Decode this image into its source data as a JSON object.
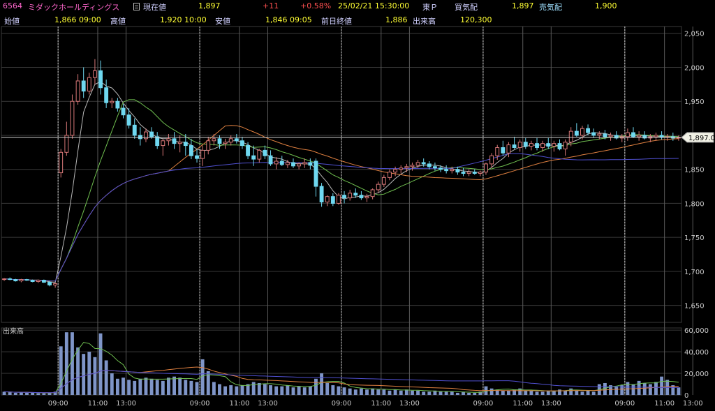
{
  "header": {
    "code": "6564",
    "name": "ミダックホールディングス",
    "current_label": "現在値",
    "current_value": "1,897",
    "change": "+11",
    "change_pct": "+0.58%",
    "datetime": "25/02/21  15:30:00",
    "market": "東Ｐ",
    "bid_label": "買気配",
    "bid_value": "1,897",
    "ask_label": "売気配",
    "ask_value": "1,900",
    "open_label": "始値",
    "open_value": "1,866",
    "open_time": "09:00",
    "high_label": "高値",
    "high_value": "1,920",
    "high_time": "10:00",
    "low_label": "安値",
    "low_value": "1,846",
    "low_time": "09:05",
    "prev_close_label": "前日終値",
    "prev_close_value": "1,886",
    "volume_label": "出来高",
    "volume_value": "120,300"
  },
  "chart_data": {
    "type": "candlestick",
    "price_ylim": [
      1625,
      2060
    ],
    "price_ticks": [
      "2,050",
      "2,000",
      "1,950",
      "1,900",
      "1,850",
      "1,800",
      "1,750",
      "1,700",
      "1,650"
    ],
    "price_tick_values": [
      2050,
      2000,
      1950,
      1900,
      1850,
      1800,
      1750,
      1700,
      1650
    ],
    "last_price_label": "1,897.0",
    "last_price": 1897,
    "volume_label": "出来高",
    "volume_ylim": [
      0,
      62000
    ],
    "volume_ticks": [
      "60,000",
      "40,000",
      "20,000",
      "0"
    ],
    "volume_tick_values": [
      60000,
      40000,
      20000,
      0
    ],
    "x_tick_labels": [
      "09:00",
      "11:00",
      "13:00",
      "09:00",
      "11:00",
      "13:00",
      "09:00",
      "11:00",
      "13:00",
      "09:00",
      "11:00",
      "13:00",
      "09:00",
      "11:00",
      "13:00"
    ],
    "x_tick_index": [
      10,
      17,
      22,
      35,
      42,
      47,
      60,
      67,
      72,
      85,
      92,
      97,
      110,
      117,
      122
    ],
    "day_boundaries": [
      10,
      35,
      60,
      85,
      110
    ],
    "grid": true,
    "colors": {
      "up": "#d87878",
      "down": "#6fd8f0",
      "ma_short": "#b8b8b8",
      "ma_mid": "#70c050",
      "ma_long": "#e08040",
      "ma_xlong": "#5050d0",
      "volume": "#7f95c8",
      "day_line": "#d0d0d0",
      "grid": "#3a3a3a"
    },
    "candles": [
      [
        1688,
        1690,
        1686,
        1689
      ],
      [
        1689,
        1691,
        1687,
        1688
      ],
      [
        1688,
        1689,
        1685,
        1686
      ],
      [
        1686,
        1689,
        1684,
        1688
      ],
      [
        1688,
        1689,
        1686,
        1687
      ],
      [
        1687,
        1688,
        1684,
        1685
      ],
      [
        1685,
        1688,
        1683,
        1687
      ],
      [
        1687,
        1688,
        1683,
        1684
      ],
      [
        1684,
        1686,
        1678,
        1680
      ],
      [
        1680,
        1683,
        1676,
        1682
      ],
      [
        1845,
        1880,
        1838,
        1875
      ],
      [
        1875,
        1920,
        1870,
        1900
      ],
      [
        1900,
        1960,
        1895,
        1950
      ],
      [
        1950,
        1990,
        1945,
        1980
      ],
      [
        1980,
        2000,
        1955,
        1965
      ],
      [
        1965,
        1992,
        1960,
        1985
      ],
      [
        1985,
        2012,
        1975,
        1995
      ],
      [
        1995,
        2010,
        1960,
        1970
      ],
      [
        1970,
        1982,
        1940,
        1948
      ],
      [
        1948,
        1955,
        1940,
        1950
      ],
      [
        1950,
        1955,
        1935,
        1940
      ],
      [
        1940,
        1946,
        1925,
        1930
      ],
      [
        1930,
        1940,
        1910,
        1915
      ],
      [
        1915,
        1925,
        1895,
        1900
      ],
      [
        1900,
        1912,
        1885,
        1895
      ],
      [
        1895,
        1910,
        1890,
        1905
      ],
      [
        1905,
        1912,
        1895,
        1898
      ],
      [
        1898,
        1905,
        1880,
        1885
      ],
      [
        1885,
        1895,
        1870,
        1892
      ],
      [
        1892,
        1902,
        1885,
        1895
      ],
      [
        1895,
        1905,
        1880,
        1888
      ],
      [
        1888,
        1900,
        1875,
        1890
      ],
      [
        1890,
        1902,
        1870,
        1885
      ],
      [
        1885,
        1895,
        1865,
        1870
      ],
      [
        1870,
        1880,
        1860,
        1866
      ],
      [
        1866,
        1885,
        1855,
        1878
      ],
      [
        1878,
        1898,
        1872,
        1892
      ],
      [
        1892,
        1902,
        1885,
        1895
      ],
      [
        1895,
        1900,
        1880,
        1888
      ],
      [
        1888,
        1895,
        1880,
        1890
      ],
      [
        1890,
        1900,
        1885,
        1895
      ],
      [
        1895,
        1902,
        1888,
        1892
      ],
      [
        1892,
        1898,
        1880,
        1885
      ],
      [
        1885,
        1890,
        1865,
        1870
      ],
      [
        1870,
        1885,
        1855,
        1865
      ],
      [
        1865,
        1880,
        1860,
        1878
      ],
      [
        1878,
        1885,
        1865,
        1870
      ],
      [
        1870,
        1878,
        1855,
        1858
      ],
      [
        1858,
        1868,
        1850,
        1862
      ],
      [
        1862,
        1870,
        1855,
        1857
      ],
      [
        1857,
        1864,
        1852,
        1860
      ],
      [
        1860,
        1866,
        1852,
        1855
      ],
      [
        1855,
        1860,
        1850,
        1858
      ],
      [
        1858,
        1866,
        1852,
        1860
      ],
      [
        1860,
        1866,
        1850,
        1856
      ],
      [
        1862,
        1866,
        1810,
        1825
      ],
      [
        1825,
        1830,
        1795,
        1802
      ],
      [
        1802,
        1812,
        1796,
        1810
      ],
      [
        1810,
        1815,
        1796,
        1800
      ],
      [
        1800,
        1815,
        1798,
        1812
      ],
      [
        1812,
        1818,
        1800,
        1808
      ],
      [
        1808,
        1820,
        1804,
        1815
      ],
      [
        1815,
        1822,
        1808,
        1812
      ],
      [
        1812,
        1818,
        1805,
        1808
      ],
      [
        1808,
        1814,
        1802,
        1810
      ],
      [
        1810,
        1822,
        1806,
        1820
      ],
      [
        1820,
        1832,
        1816,
        1828
      ],
      [
        1828,
        1842,
        1824,
        1838
      ],
      [
        1838,
        1850,
        1834,
        1846
      ],
      [
        1846,
        1854,
        1840,
        1850
      ],
      [
        1850,
        1856,
        1844,
        1852
      ],
      [
        1852,
        1858,
        1846,
        1854
      ],
      [
        1854,
        1860,
        1848,
        1856
      ],
      [
        1856,
        1864,
        1852,
        1860
      ],
      [
        1860,
        1866,
        1854,
        1858
      ],
      [
        1858,
        1862,
        1850,
        1854
      ],
      [
        1854,
        1860,
        1848,
        1852
      ],
      [
        1852,
        1856,
        1846,
        1850
      ],
      [
        1850,
        1856,
        1844,
        1848
      ],
      [
        1848,
        1854,
        1844,
        1850
      ],
      [
        1850,
        1854,
        1842,
        1846
      ],
      [
        1846,
        1852,
        1840,
        1844
      ],
      [
        1844,
        1850,
        1840,
        1846
      ],
      [
        1846,
        1850,
        1842,
        1844
      ],
      [
        1844,
        1848,
        1840,
        1846
      ],
      [
        1846,
        1860,
        1842,
        1858
      ],
      [
        1858,
        1874,
        1852,
        1870
      ],
      [
        1870,
        1886,
        1864,
        1882
      ],
      [
        1882,
        1892,
        1870,
        1874
      ],
      [
        1874,
        1890,
        1868,
        1886
      ],
      [
        1886,
        1898,
        1880,
        1882
      ],
      [
        1882,
        1894,
        1876,
        1890
      ],
      [
        1890,
        1896,
        1880,
        1884
      ],
      [
        1884,
        1892,
        1878,
        1888
      ],
      [
        1888,
        1896,
        1878,
        1882
      ],
      [
        1882,
        1892,
        1876,
        1888
      ],
      [
        1888,
        1896,
        1880,
        1884
      ],
      [
        1884,
        1892,
        1876,
        1888
      ],
      [
        1888,
        1894,
        1878,
        1880
      ],
      [
        1880,
        1894,
        1870,
        1890
      ],
      [
        1890,
        1912,
        1884,
        1906
      ],
      [
        1906,
        1918,
        1898,
        1900
      ],
      [
        1900,
        1914,
        1894,
        1910
      ],
      [
        1910,
        1916,
        1900,
        1904
      ],
      [
        1904,
        1910,
        1896,
        1900
      ],
      [
        1900,
        1906,
        1894,
        1902
      ],
      [
        1902,
        1908,
        1894,
        1898
      ],
      [
        1898,
        1904,
        1892,
        1900
      ],
      [
        1900,
        1906,
        1894,
        1896
      ],
      [
        1896,
        1902,
        1890,
        1898
      ],
      [
        1898,
        1910,
        1892,
        1904
      ],
      [
        1904,
        1912,
        1896,
        1898
      ],
      [
        1898,
        1906,
        1892,
        1900
      ],
      [
        1900,
        1906,
        1894,
        1896
      ],
      [
        1896,
        1902,
        1890,
        1898
      ],
      [
        1898,
        1904,
        1892,
        1900
      ],
      [
        1900,
        1906,
        1894,
        1897
      ],
      [
        1897,
        1902,
        1892,
        1898
      ],
      [
        1898,
        1904,
        1892,
        1896
      ],
      [
        1896,
        1900,
        1892,
        1897
      ]
    ],
    "volume": [
      3000,
      2500,
      2000,
      2500,
      2000,
      2000,
      1500,
      1500,
      2000,
      3000,
      45000,
      58000,
      58000,
      44000,
      38000,
      40000,
      35000,
      57000,
      32000,
      20000,
      15000,
      16000,
      14000,
      13000,
      15000,
      16000,
      15000,
      14000,
      13000,
      16000,
      17000,
      16000,
      14000,
      13000,
      12000,
      33000,
      22000,
      12000,
      10000,
      8000,
      9000,
      8000,
      9000,
      10000,
      12000,
      11000,
      10000,
      9000,
      8000,
      8000,
      9000,
      7000,
      8000,
      7000,
      8000,
      15000,
      20000,
      11000,
      9000,
      8000,
      7000,
      6000,
      5000,
      6000,
      5000,
      6000,
      5000,
      5000,
      4000,
      5000,
      4000,
      5000,
      4000,
      4000,
      3000,
      3000,
      4000,
      3000,
      3000,
      3000,
      2000,
      3000,
      2000,
      2000,
      3000,
      8000,
      6000,
      5000,
      4000,
      4000,
      5000,
      6000,
      4000,
      4000,
      3000,
      3000,
      4000,
      4000,
      5000,
      4000,
      6000,
      4000,
      3000,
      4000,
      3000,
      10000,
      11000,
      9000,
      8000,
      9000,
      12000,
      10000,
      13000,
      11000,
      10000,
      12000,
      17000,
      14000,
      9000,
      7000,
      6000,
      4000,
      3000,
      4000,
      3000,
      5000,
      6000,
      4000,
      4000,
      3000,
      3000,
      3000,
      3000,
      4000,
      8000
    ],
    "ma_short": [],
    "ma_mid": [],
    "ma_long": [],
    "ma_xlong": []
  }
}
